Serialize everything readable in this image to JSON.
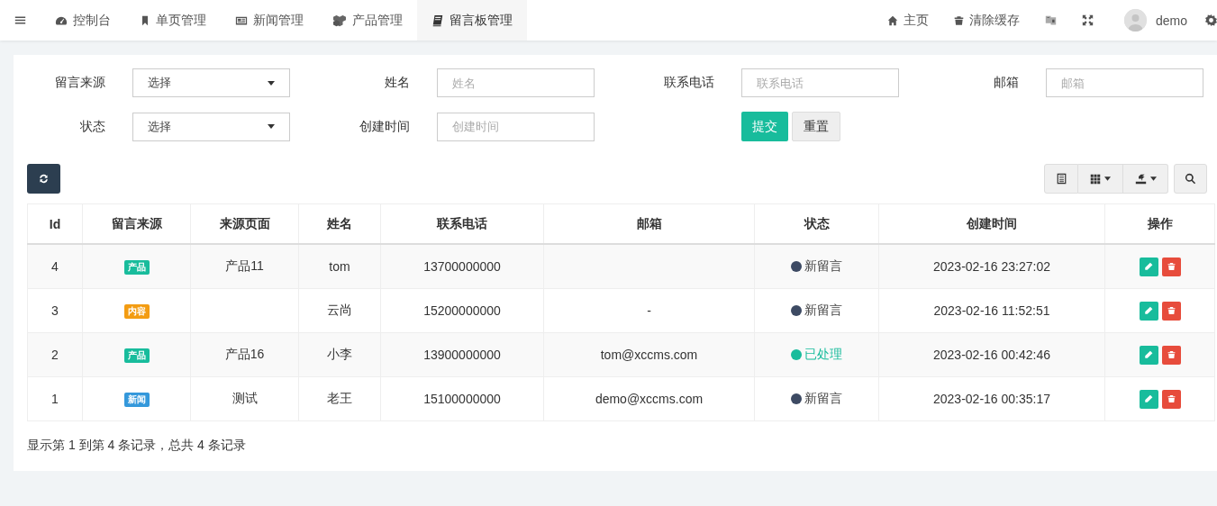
{
  "nav": {
    "menu_items": [
      {
        "label": "控制台",
        "selected": false
      },
      {
        "label": "单页管理",
        "selected": false
      },
      {
        "label": "新闻管理",
        "selected": false
      },
      {
        "label": "产品管理",
        "selected": false
      },
      {
        "label": "留言板管理",
        "selected": true
      }
    ],
    "right_items": [
      {
        "label": "主页"
      },
      {
        "label": "清除缓存"
      }
    ],
    "user": "demo"
  },
  "filters": [
    {
      "label": "留言来源",
      "kind": "select",
      "value": "选择"
    },
    {
      "label": "姓名",
      "kind": "input",
      "placeholder": "姓名"
    },
    {
      "label": "联系电话",
      "kind": "input",
      "placeholder": "联系电话"
    },
    {
      "label": "邮箱",
      "kind": "input",
      "placeholder": "邮箱"
    },
    {
      "label": "状态",
      "kind": "select",
      "value": "选择"
    },
    {
      "label": "创建时间",
      "kind": "input",
      "placeholder": "创建时间"
    }
  ],
  "form_buttons": [
    "提交",
    "重置"
  ],
  "table": {
    "columns": [
      "Id",
      "留言来源",
      "来源页面",
      "姓名",
      "联系电话",
      "邮箱",
      "状态",
      "创建时间",
      "操作"
    ],
    "rows": [
      {
        "id": "4",
        "source": {
          "label": "产品",
          "color": "#18bc9c"
        },
        "page": "产品11",
        "name": "tom",
        "phone": "13700000000",
        "status": {
          "label": "新留言",
          "color": "#3d4a63",
          "kind": "new"
        },
        "created": "2023-02-16 23:27:02"
      },
      {
        "id": "3",
        "source": {
          "label": "内容",
          "color": "#f39c12"
        },
        "name": "云尚",
        "phone": "15200000000",
        "email": "-",
        "status": {
          "label": "新留言",
          "color": "#3d4a63",
          "kind": "new"
        },
        "created": "2023-02-16 11:52:51"
      },
      {
        "id": "2",
        "source": {
          "label": "产品",
          "color": "#18bc9c"
        },
        "page": "产品16",
        "name": "小李",
        "phone": "13900000000",
        "email": "tom@xccms.com",
        "status": {
          "label": "已处理",
          "color": "#18bc9c",
          "kind": "done"
        },
        "created": "2023-02-16 00:42:46"
      },
      {
        "id": "1",
        "source": {
          "label": "新闻",
          "color": "#3498db"
        },
        "page": "测试",
        "name": "老王",
        "phone": "15100000000",
        "email": "demo@xccms.com",
        "status": {
          "label": "新留言",
          "color": "#3d4a63",
          "kind": "new"
        },
        "created": "2023-02-16 00:35:17"
      }
    ]
  },
  "pagination_info": "显示第 1 到第 4 条记录，总共 4 条记录"
}
